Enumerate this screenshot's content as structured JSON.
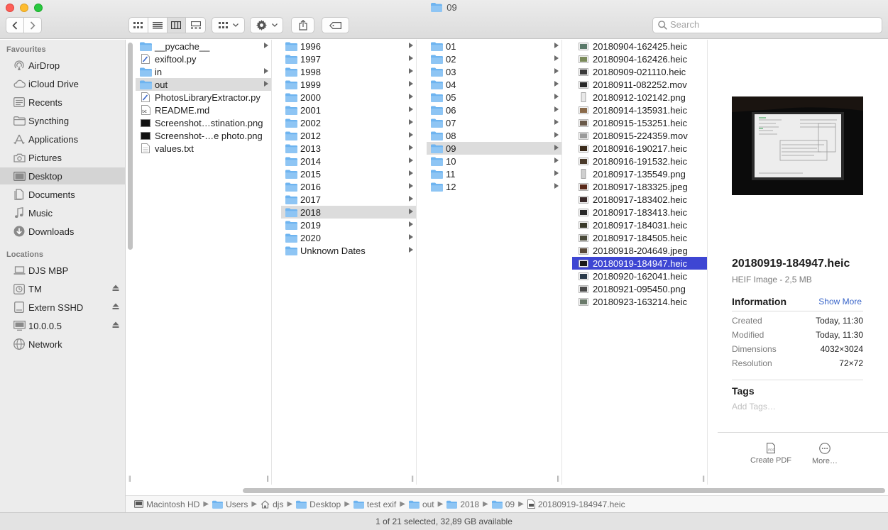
{
  "window": {
    "title": "09"
  },
  "toolbar": {
    "search_placeholder": "Search"
  },
  "sidebar": {
    "favourites_header": "Favourites",
    "favourites": [
      {
        "label": "AirDrop",
        "icon": "airdrop-icon"
      },
      {
        "label": "iCloud Drive",
        "icon": "cloud-icon"
      },
      {
        "label": "Recents",
        "icon": "recents-icon"
      },
      {
        "label": "Syncthing",
        "icon": "folder-icon"
      },
      {
        "label": "Applications",
        "icon": "applications-icon"
      },
      {
        "label": "Pictures",
        "icon": "camera-icon"
      },
      {
        "label": "Desktop",
        "icon": "desktop-icon",
        "selected": true
      },
      {
        "label": "Documents",
        "icon": "documents-icon"
      },
      {
        "label": "Music",
        "icon": "music-icon"
      },
      {
        "label": "Downloads",
        "icon": "downloads-icon"
      }
    ],
    "locations_header": "Locations",
    "locations": [
      {
        "label": "DJS MBP",
        "icon": "laptop-icon"
      },
      {
        "label": "TM",
        "icon": "time-machine-icon",
        "eject": true
      },
      {
        "label": "Extern SSHD",
        "icon": "drive-icon",
        "eject": true
      },
      {
        "label": "10.0.0.5",
        "icon": "server-icon",
        "eject": true
      },
      {
        "label": "Network",
        "icon": "network-icon"
      }
    ]
  },
  "columns": {
    "col1": [
      {
        "name": "__pycache__",
        "type": "folder",
        "arrow": true
      },
      {
        "name": "exiftool.py",
        "type": "py",
        "arrow": false
      },
      {
        "name": "in",
        "type": "folder",
        "arrow": true
      },
      {
        "name": "out",
        "type": "folder",
        "arrow": true,
        "selected": true
      },
      {
        "name": "PhotosLibraryExtractor.py",
        "type": "py",
        "arrow": false
      },
      {
        "name": "README.md",
        "type": "md",
        "arrow": false
      },
      {
        "name": "Screenshot…stination.png",
        "type": "png-dark",
        "arrow": false
      },
      {
        "name": "Screenshot-…e photo.png",
        "type": "png-dark",
        "arrow": false
      },
      {
        "name": "values.txt",
        "type": "txt",
        "arrow": false
      }
    ],
    "col2": [
      {
        "name": "1996"
      },
      {
        "name": "1997"
      },
      {
        "name": "1998"
      },
      {
        "name": "1999"
      },
      {
        "name": "2000"
      },
      {
        "name": "2001"
      },
      {
        "name": "2002"
      },
      {
        "name": "2012"
      },
      {
        "name": "2013"
      },
      {
        "name": "2014"
      },
      {
        "name": "2015"
      },
      {
        "name": "2016"
      },
      {
        "name": "2017"
      },
      {
        "name": "2018",
        "selected": true
      },
      {
        "name": "2019"
      },
      {
        "name": "2020"
      },
      {
        "name": "Unknown Dates"
      }
    ],
    "col3": [
      {
        "name": "01"
      },
      {
        "name": "02"
      },
      {
        "name": "03"
      },
      {
        "name": "04"
      },
      {
        "name": "05"
      },
      {
        "name": "06"
      },
      {
        "name": "07"
      },
      {
        "name": "08"
      },
      {
        "name": "09",
        "selected": true
      },
      {
        "name": "10"
      },
      {
        "name": "11"
      },
      {
        "name": "12"
      }
    ],
    "col4": [
      {
        "name": "20180904-162425.heic",
        "thumb": "#5a7a6a"
      },
      {
        "name": "20180904-162426.heic",
        "thumb": "#7a8a5a"
      },
      {
        "name": "20180909-021110.heic",
        "thumb": "#3a3a3a"
      },
      {
        "name": "20180911-082252.mov",
        "thumb": "#2a2a2a"
      },
      {
        "name": "20180912-102142.png",
        "thumb": "#e8e8e8"
      },
      {
        "name": "20180914-135931.heic",
        "thumb": "#8a6a4a"
      },
      {
        "name": "20180915-153251.heic",
        "thumb": "#6a5a4a"
      },
      {
        "name": "20180915-224359.mov",
        "thumb": "#9a9a9a"
      },
      {
        "name": "20180916-190217.heic",
        "thumb": "#3a2a1a"
      },
      {
        "name": "20180916-191532.heic",
        "thumb": "#4a3a2a"
      },
      {
        "name": "20180917-135549.png",
        "thumb": "#cfcfcf"
      },
      {
        "name": "20180917-183325.jpeg",
        "thumb": "#5a2a1a"
      },
      {
        "name": "20180917-183402.heic",
        "thumb": "#3a2a2a"
      },
      {
        "name": "20180917-183413.heic",
        "thumb": "#2a2a2a"
      },
      {
        "name": "20180917-184031.heic",
        "thumb": "#3a3a2a"
      },
      {
        "name": "20180917-184505.heic",
        "thumb": "#4a4a3a"
      },
      {
        "name": "20180918-204649.jpeg",
        "thumb": "#5a4a3a"
      },
      {
        "name": "20180919-184947.heic",
        "thumb": "#1a1a1a",
        "selected": true
      },
      {
        "name": "20180920-162041.heic",
        "thumb": "#2a3a4a"
      },
      {
        "name": "20180921-095450.png",
        "thumb": "#4a4a4a"
      },
      {
        "name": "20180923-163214.heic",
        "thumb": "#6a7a6a"
      }
    ]
  },
  "preview": {
    "filename": "20180919-184947.heic",
    "kind": "HEIF Image - 2,5 MB",
    "info_header": "Information",
    "show_more": "Show More",
    "info": [
      {
        "key": "Created",
        "value": "Today, 11:30"
      },
      {
        "key": "Modified",
        "value": "Today, 11:30"
      },
      {
        "key": "Dimensions",
        "value": "4032×3024"
      },
      {
        "key": "Resolution",
        "value": "72×72"
      }
    ],
    "tags_header": "Tags",
    "add_tags": "Add Tags…",
    "actions": [
      {
        "label": "Create PDF",
        "icon": "create-pdf-icon"
      },
      {
        "label": "More…",
        "icon": "more-icon"
      }
    ]
  },
  "pathbar": [
    {
      "label": "Macintosh HD",
      "icon": "hard-drive-icon"
    },
    {
      "label": "Users",
      "icon": "folder-icon"
    },
    {
      "label": "djs",
      "icon": "home-icon"
    },
    {
      "label": "Desktop",
      "icon": "folder-icon"
    },
    {
      "label": "test exif",
      "icon": "folder-icon"
    },
    {
      "label": "out",
      "icon": "folder-icon"
    },
    {
      "label": "2018",
      "icon": "folder-icon"
    },
    {
      "label": "09",
      "icon": "folder-icon"
    },
    {
      "label": "20180919-184947.heic",
      "icon": "file-icon"
    }
  ],
  "status": {
    "text": "1 of 21 selected, 32,89 GB available"
  },
  "colors": {
    "folder": "#6eb4f0",
    "selection": "#3e46d3",
    "link": "#3a66c9"
  }
}
